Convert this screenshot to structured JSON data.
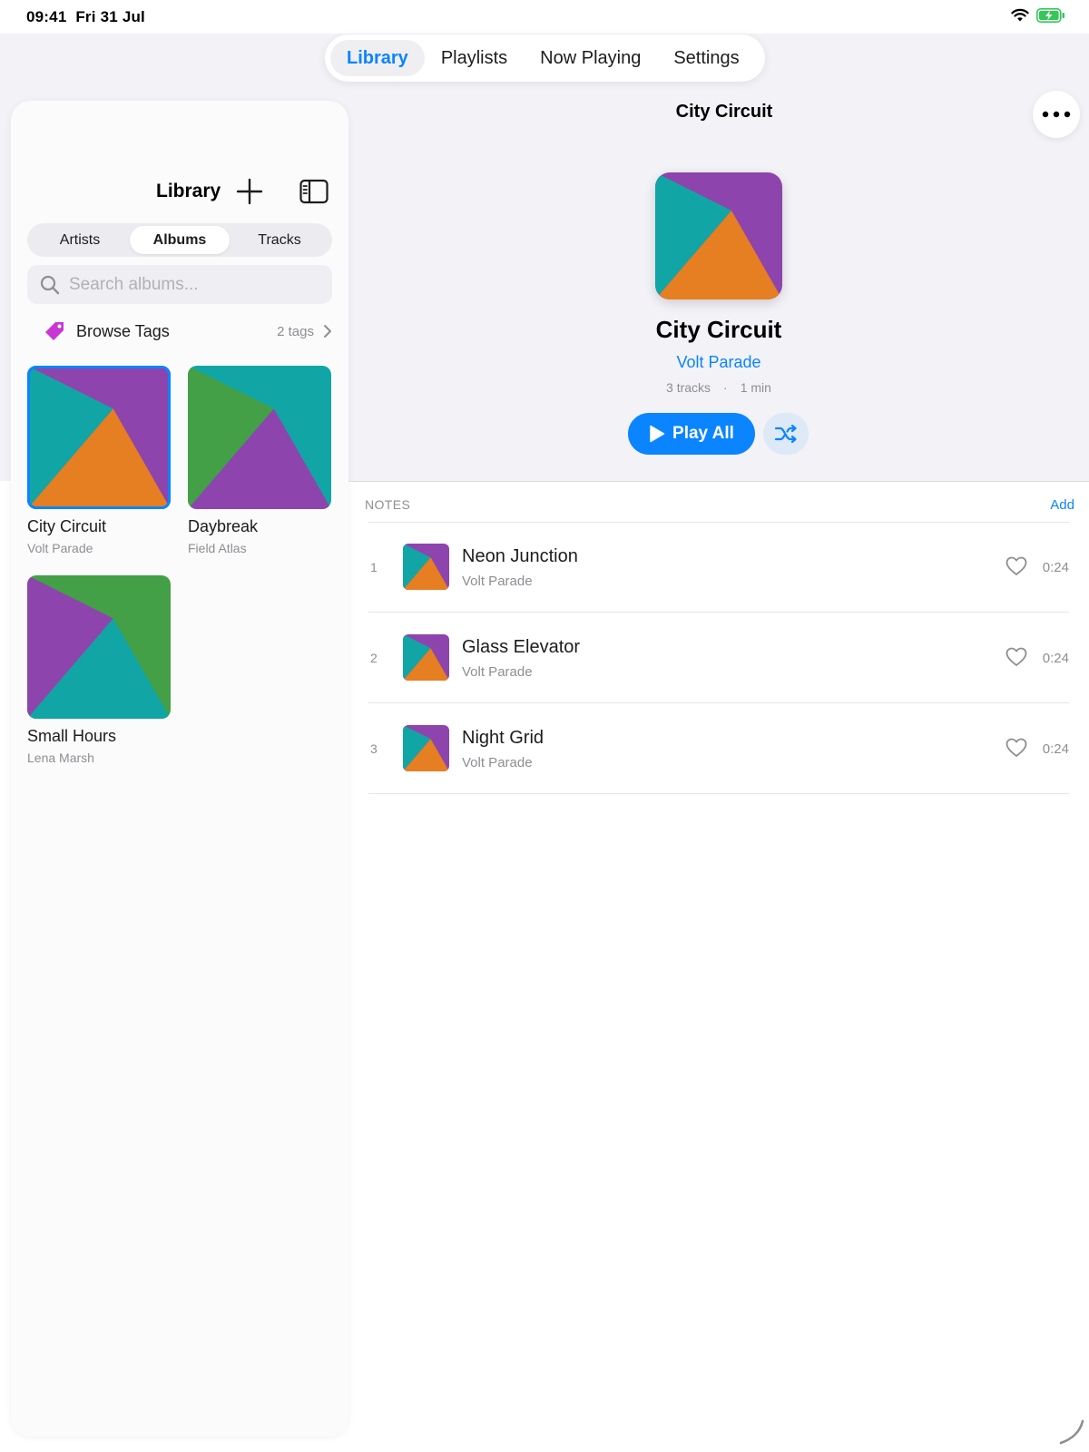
{
  "status_bar": {
    "time": "09:41",
    "date": "Fri 31 Jul"
  },
  "top_nav": {
    "tabs": [
      "Library",
      "Playlists",
      "Now Playing",
      "Settings"
    ],
    "active": "Library"
  },
  "sidebar": {
    "title": "Library",
    "segments": [
      "Artists",
      "Albums",
      "Tracks"
    ],
    "active_segment": "Albums",
    "search_placeholder": "Search albums...",
    "browse_tags": {
      "label": "Browse Tags",
      "count": "2 tags"
    },
    "albums": [
      {
        "title": "City Circuit",
        "artist": "Volt Parade",
        "selected": true
      },
      {
        "title": "Daybreak",
        "artist": "Field Atlas",
        "selected": false
      },
      {
        "title": "Small Hours",
        "artist": "Lena Marsh",
        "selected": false
      }
    ]
  },
  "detail": {
    "nav_title": "City Circuit",
    "title": "City Circuit",
    "artist": "Volt Parade",
    "track_count": "3 tracks",
    "duration": "1 min",
    "play_all_label": "Play All",
    "notes_label": "NOTES",
    "notes_add_label": "Add",
    "tracks": [
      {
        "num": "1",
        "title": "Neon Junction",
        "artist": "Volt Parade",
        "duration": "0:24"
      },
      {
        "num": "2",
        "title": "Glass Elevator",
        "artist": "Volt Parade",
        "duration": "0:24"
      },
      {
        "num": "3",
        "title": "Night Grid",
        "artist": "Volt Parade",
        "duration": "0:24"
      }
    ]
  },
  "colors": {
    "accent": "#0a84ff",
    "art_purple": "#8e44ad",
    "art_teal": "#12a5a5",
    "art_orange": "#e67e22",
    "art_green": "#43a047",
    "tag_magenta": "#c837d4"
  },
  "icons": [
    "wifi-icon",
    "battery-charging-icon",
    "plus-icon",
    "sidebar-toggle-icon",
    "search-icon",
    "tag-icon",
    "chevron-right-icon",
    "ellipsis-icon",
    "play-icon",
    "shuffle-icon",
    "heart-icon"
  ]
}
